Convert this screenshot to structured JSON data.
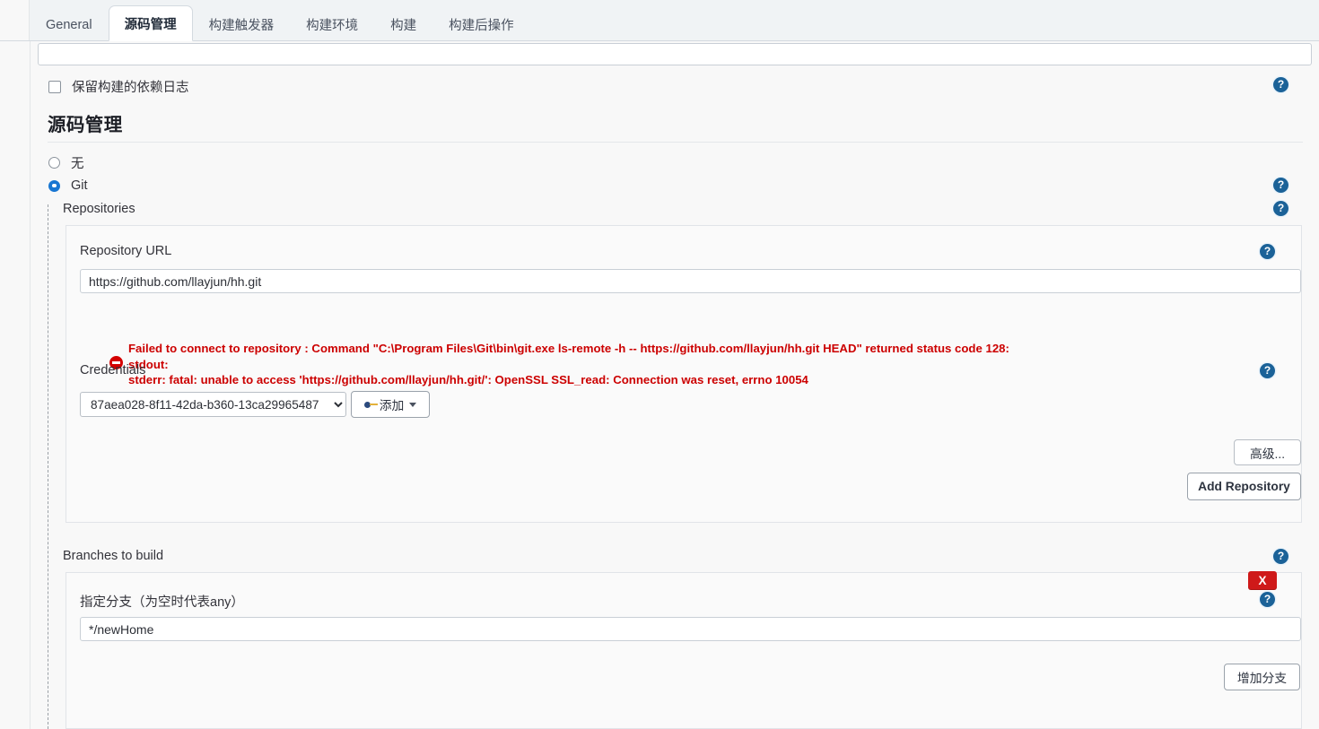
{
  "tabs": [
    {
      "label": "General",
      "active": false
    },
    {
      "label": "源码管理",
      "active": true
    },
    {
      "label": "构建触发器",
      "active": false
    },
    {
      "label": "构建环境",
      "active": false
    },
    {
      "label": "构建",
      "active": false
    },
    {
      "label": "构建后操作",
      "active": false
    }
  ],
  "options": {
    "keep_dependency_log_label": "保留构建的依赖日志",
    "keep_dependency_log_checked": false
  },
  "scm": {
    "heading": "源码管理",
    "radios": [
      {
        "label": "无",
        "selected": false
      },
      {
        "label": "Git",
        "selected": true
      }
    ],
    "repositories_label": "Repositories",
    "repository_url_label": "Repository URL",
    "repository_url_value": "https://github.com/llayjun/hh.git",
    "error": {
      "line1": "Failed to connect to repository : Command \"C:\\Program Files\\Git\\bin\\git.exe ls-remote -h -- https://github.com/llayjun/hh.git HEAD\" returned status code 128:",
      "line2": "stdout:",
      "line3": "stderr: fatal: unable to access 'https://github.com/llayjun/hh.git/': OpenSSL SSL_read: Connection was reset, errno 10054",
      "color": "#cc0000"
    },
    "credentials_label": "Credentials",
    "credentials_value": "87aea028-8f11-42da-b360-13ca29965487",
    "credentials_options": [
      "87aea028-8f11-42da-b360-13ca29965487"
    ],
    "add_credentials_button": "添加",
    "advanced_button": "高级...",
    "add_repository_button": "Add Repository",
    "branches_label": "Branches to build",
    "branch_spec_label": "指定分支（为空时代表any）",
    "branch_spec_value": "*/newHome",
    "delete_branch_button": "X",
    "add_branch_button": "增加分支",
    "help_icon_glyph": "?"
  },
  "colors": {
    "accent": "#1976d2",
    "help_icon": "#1b6298",
    "error": "#cc0000",
    "delete": "#cf1919",
    "tabbar_bg": "#f0f3f5",
    "page_bg": "#f8f8f8"
  }
}
